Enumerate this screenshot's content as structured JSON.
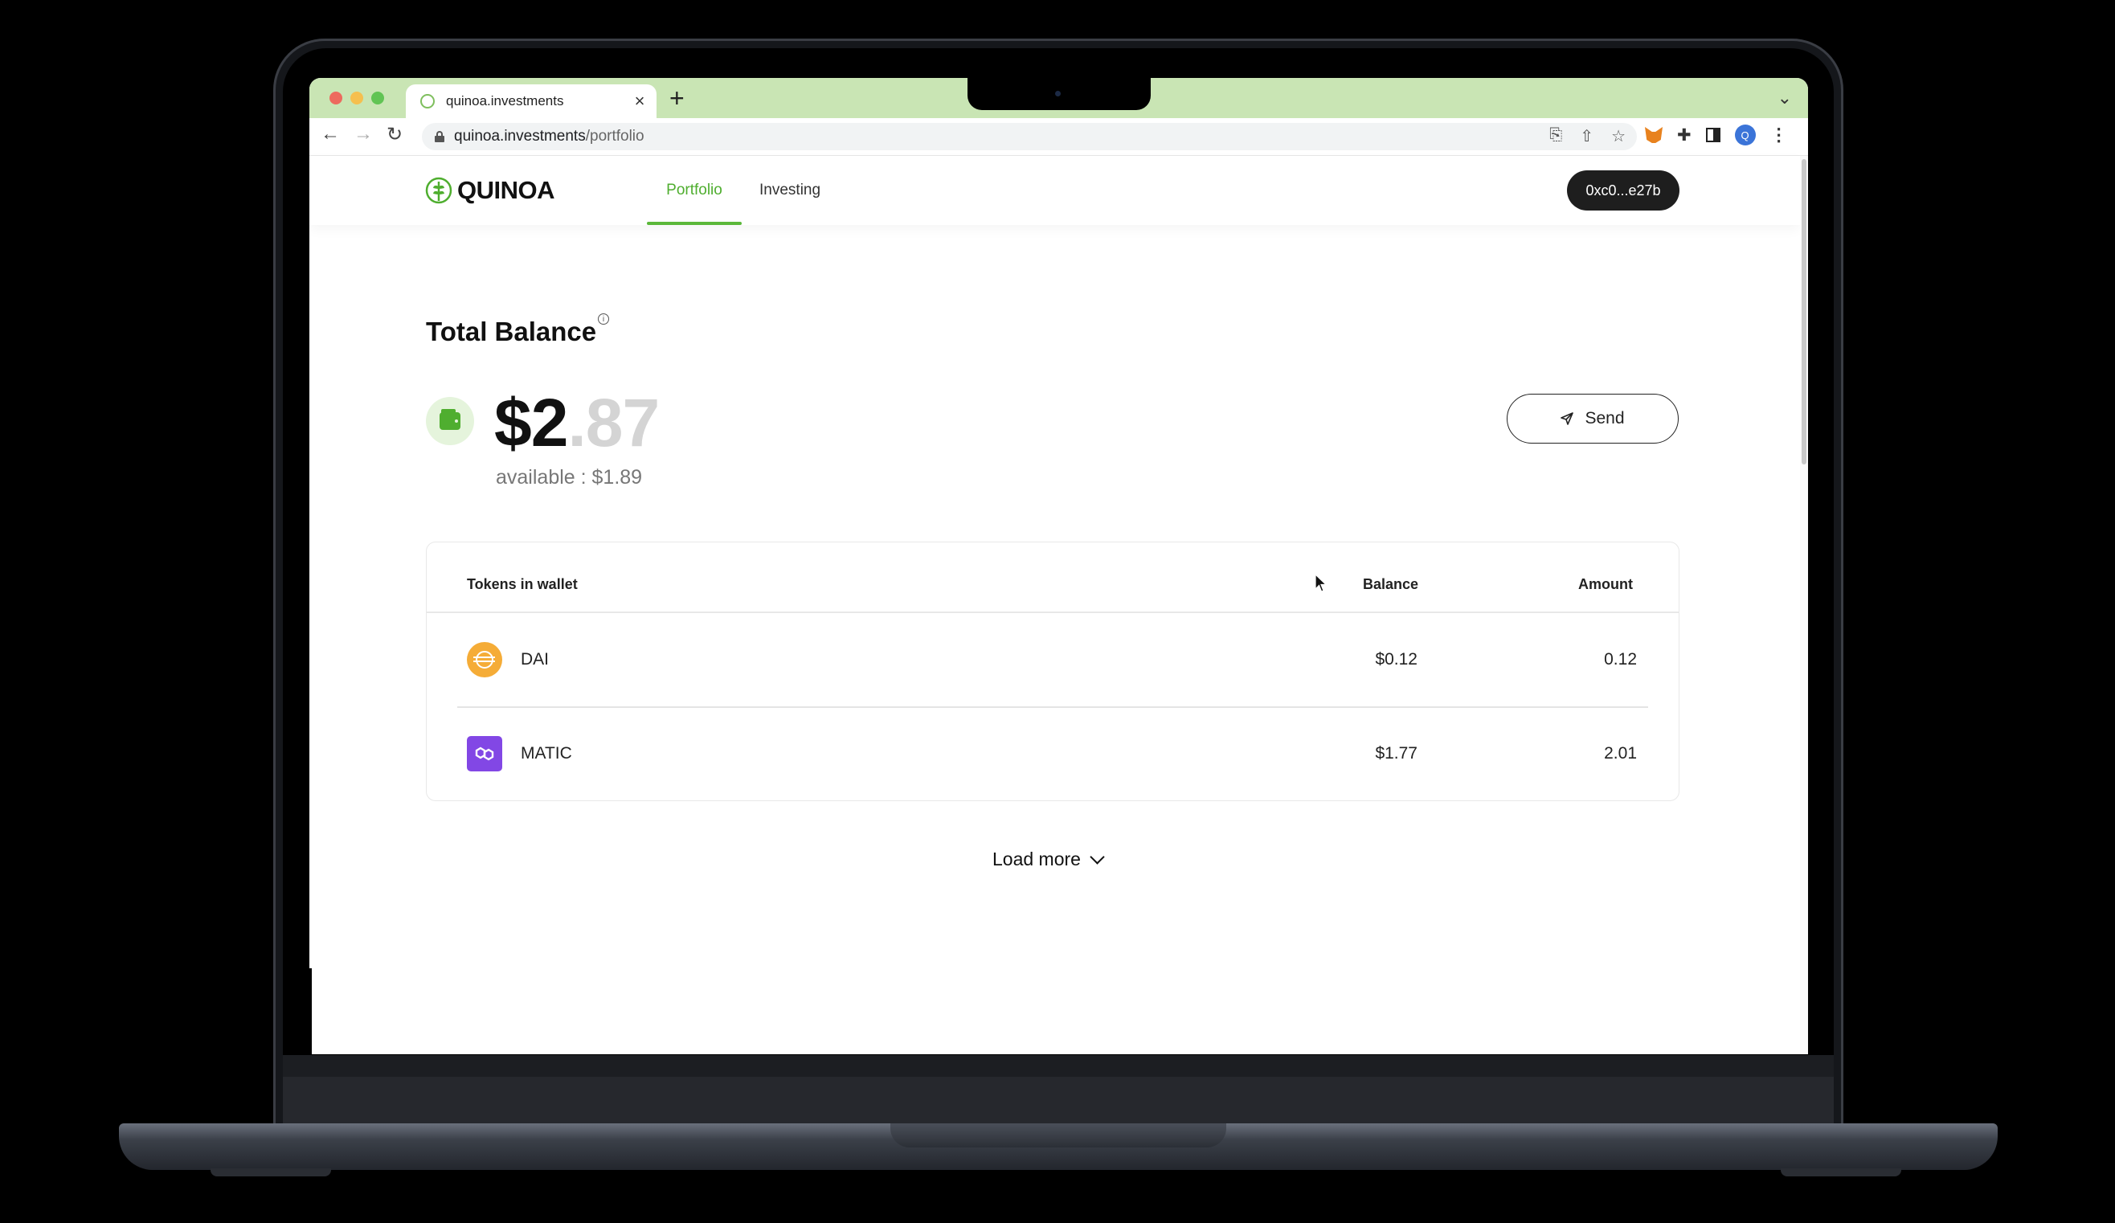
{
  "browser": {
    "tab_title": "quinoa.investments",
    "tab_close": "×",
    "new_tab": "+",
    "url_host": "quinoa.investments",
    "url_path": "/portfolio",
    "profile_initial": "Q"
  },
  "header": {
    "logo_text": "QUINOA",
    "nav": [
      {
        "label": "Portfolio",
        "active": true
      },
      {
        "label": "Investing",
        "active": false
      }
    ],
    "wallet_address": "0xc0...e27b"
  },
  "balance": {
    "title": "Total Balance",
    "info": "i",
    "whole": "$2",
    "cents": ".87",
    "available": "available : $1.89",
    "send_label": "Send"
  },
  "tokens": {
    "headers": {
      "token": "Tokens in wallet",
      "balance": "Balance",
      "amount": "Amount"
    },
    "rows": [
      {
        "name": "DAI",
        "balance": "$0.12",
        "amount": "0.12",
        "icon": "dai-icon"
      },
      {
        "name": "MATIC",
        "balance": "$1.77",
        "amount": "2.01",
        "icon": "matic-icon"
      }
    ]
  },
  "load_more_label": "Load more",
  "colors": {
    "brand_green": "#4fae2f",
    "tabstrip": "#c9e5b4",
    "dai": "#f5ac37",
    "matic": "#8247e5"
  }
}
